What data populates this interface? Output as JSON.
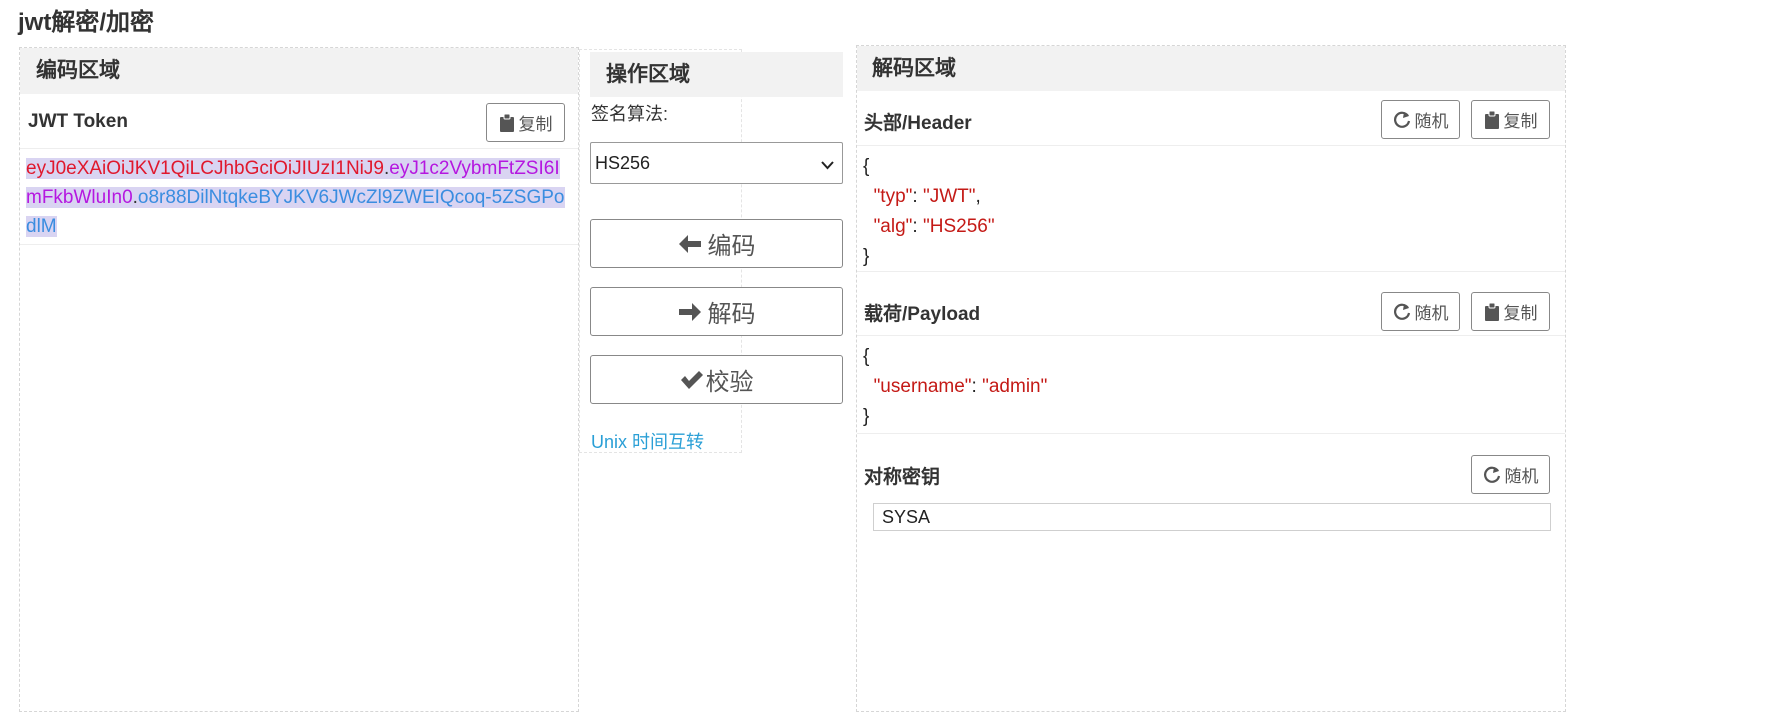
{
  "page": {
    "title": "jwt解密/加密"
  },
  "encode_panel": {
    "heading": "编码区域",
    "token_label": "JWT Token",
    "copy_label": "复制",
    "token_header": "eyJ0eXAiOiJKV1QiLCJhbGciOiJIUzI1NiJ9",
    "token_payload": "eyJ1c2VybmFtZSI6ImFkbWluIn0",
    "token_signature": "o8r88DilNtqkeBYJKV6JWcZl9ZWEIQcoq-5ZSGPodlM",
    "separator": "."
  },
  "ops_panel": {
    "heading": "操作区域",
    "algorithm_label": "签名算法:",
    "algorithm_value": "HS256",
    "encode_label": "编码",
    "decode_label": "解码",
    "verify_label": "校验",
    "unix_link": "Unix 时间互转"
  },
  "decode_panel": {
    "heading": "解码区域",
    "header_label": "头部/Header",
    "payload_label": "载荷/Payload",
    "secret_label": "对称密钥",
    "random_label": "随机",
    "copy_label": "复制",
    "header_json": {
      "open": "{",
      "k1": "\"typ\"",
      "v1": "\"JWT\"",
      "k2": "\"alg\"",
      "v2": "\"HS256\"",
      "close": "}"
    },
    "payload_json": {
      "open": "{",
      "k1": "\"username\"",
      "v1": "\"admin\"",
      "close": "}"
    },
    "secret_value": "SYSA"
  },
  "colors": {
    "json_key": "#c41a16",
    "link": "#2a9fd6",
    "token_header": "#e0182d",
    "token_payload": "#b517e0",
    "token_signature": "#3a8de0",
    "selection": "#d9d4f2"
  }
}
